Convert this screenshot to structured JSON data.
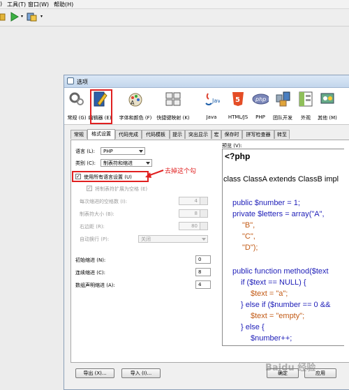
{
  "menubar": {
    "item1": ")",
    "tools": "工具(T)",
    "window": "窗口(W)",
    "help": "帮助(H)"
  },
  "icons": {
    "run": "run-icon",
    "build": "build-icon",
    "open": "open-icon"
  },
  "dialog": {
    "title": "选项",
    "categories": [
      {
        "label": "常规 (G)",
        "icon": "general-icon"
      },
      {
        "label": "编辑器 (E)",
        "icon": "editor-icon"
      },
      {
        "label": "字体和颜色 (F)",
        "icon": "fonts-colors-icon"
      },
      {
        "label": "快捷键映射 (K)",
        "icon": "keymap-icon"
      },
      {
        "label": "Java",
        "icon": "java-icon"
      },
      {
        "label": "HTML/JS",
        "icon": "html5-icon"
      },
      {
        "label": "PHP",
        "icon": "php-icon"
      },
      {
        "label": "团队开发",
        "icon": "team-icon"
      },
      {
        "label": "外观",
        "icon": "appearance-icon"
      },
      {
        "label": "其他 (M)",
        "icon": "misc-icon"
      }
    ],
    "tabs": [
      "常规",
      "格式设置",
      "代码完成",
      "代码模板",
      "提示",
      "突出显示",
      "宏",
      "保存时",
      "拼写检查器",
      "转至"
    ],
    "form": {
      "language_label": "语言 (L):",
      "language_value": "PHP",
      "category_label": "类别 (C):",
      "category_value": "制表符和缩进",
      "use_all_label": "使用所有语言设置 (U)",
      "use_all_checked": "✓",
      "expand_tabs_label": "将制表符扩展为空格 (E)",
      "expand_tabs_checked": "✓",
      "indent_label": "每次缩进的空格数 (I):",
      "indent_value": "4",
      "tab_size_label": "制表符大小 (B):",
      "tab_size_value": "8",
      "right_margin_label": "右边距 (R):",
      "right_margin_value": "80",
      "wrap_label": "自动换行 (P):",
      "wrap_value": "关闭",
      "initial_indent_label": "初始缩进 (N):",
      "initial_indent_value": "0",
      "continuation_label": "连续缩进 (C):",
      "continuation_value": "8",
      "array_indent_label": "数组声明缩进 (A):",
      "array_indent_value": "4"
    },
    "preview_label": "预览 (V):",
    "code_lines": [
      "<?php",
      "class ClassA extends ClassB impl",
      "public $number = 1;",
      "private $letters = array(\"A\",",
      "\"B\",",
      "\"C\",",
      "\"D\");",
      "public function method($text",
      "if ($text == NULL) {",
      "$text = \"a\";",
      "} else if ($number == 0 &&",
      "$text = \"empty\";",
      "} else {",
      "$number++;"
    ],
    "buttons": {
      "export": "导出 (X)...",
      "import": "导入 (I)...",
      "ok": "确定",
      "apply": "应用"
    }
  },
  "annotation": "去掉这个勾",
  "watermark": "Baidu 经验",
  "colors": {
    "highlight": "#e02020",
    "keyword": "#1d1db8",
    "string": "#c25a15"
  }
}
